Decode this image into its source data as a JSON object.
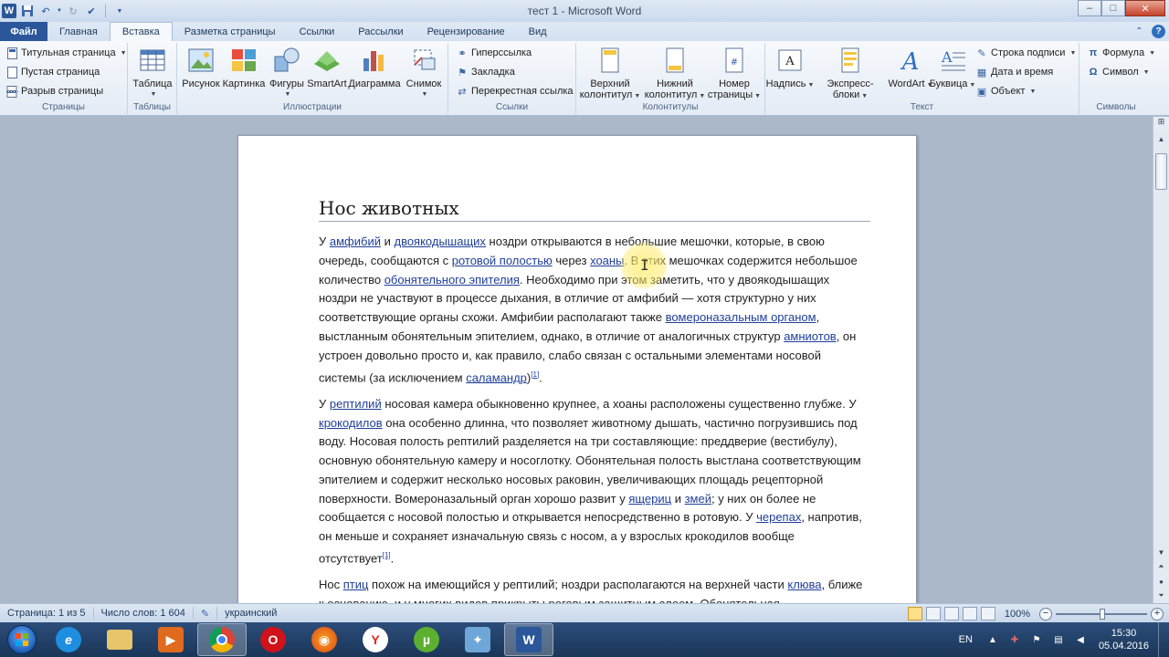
{
  "window": {
    "title": "тест 1 - Microsoft Word",
    "controls": {
      "minimize": "–",
      "maximize": "□",
      "close": "✕"
    }
  },
  "quick_access": {
    "app_letter": "W"
  },
  "tabs": [
    {
      "label": "Файл"
    },
    {
      "label": "Главная"
    },
    {
      "label": "Вставка"
    },
    {
      "label": "Разметка страницы"
    },
    {
      "label": "Ссылки"
    },
    {
      "label": "Рассылки"
    },
    {
      "label": "Рецензирование"
    },
    {
      "label": "Вид"
    }
  ],
  "ribbon": {
    "pages": {
      "label": "Страницы",
      "title_page": "Титульная страница",
      "blank_page": "Пустая страница",
      "page_break": "Разрыв страницы"
    },
    "tables": {
      "label": "Таблицы",
      "table": "Таблица"
    },
    "illustrations": {
      "label": "Иллюстрации",
      "picture": "Рисунок",
      "clipart": "Картинка",
      "shapes": "Фигуры",
      "smartart": "SmartArt",
      "chart": "Диаграмма",
      "screenshot": "Снимок"
    },
    "links": {
      "label": "Ссылки",
      "hyperlink": "Гиперссылка",
      "bookmark": "Закладка",
      "crossref": "Перекрестная ссылка"
    },
    "header_footer": {
      "label": "Колонтитулы",
      "header_1": "Верхний",
      "header_2": "колонтитул",
      "footer_1": "Нижний",
      "footer_2": "колонтитул",
      "pagenum_1": "Номер",
      "pagenum_2": "страницы"
    },
    "text": {
      "label": "Текст",
      "textbox": "Надпись",
      "quickparts": "Экспресс-блоки",
      "wordart": "WordArt",
      "dropcap": "Буквица",
      "signature": "Строка подписи",
      "datetime": "Дата и время",
      "object": "Объект"
    },
    "symbols": {
      "label": "Символы",
      "equation": "Формула",
      "symbol": "Символ"
    }
  },
  "document": {
    "heading": "Нос животных",
    "paragraphs": [
      [
        {
          "t": "У "
        },
        {
          "t": "амфибий",
          "link": true
        },
        {
          "t": " и "
        },
        {
          "t": "двоякодышащих",
          "link": true
        },
        {
          "t": " ноздри открываются в небольшие мешочки, которые, в свою очередь, сообщаются с "
        },
        {
          "t": "ротовой полостью",
          "link": true
        },
        {
          "t": " через "
        },
        {
          "t": "хоаны",
          "link": true
        },
        {
          "t": ". В этих мешочках содержится небольшое количество "
        },
        {
          "t": "обонятельного эпителия",
          "link": true
        },
        {
          "t": ". Необходимо при этом заметить, что у двоякодышащих ноздри не участвуют в процессе дыхания, в отличие от амфибий — хотя структурно у них соответствующие органы схожи. Амфибии располагают также "
        },
        {
          "t": "вомероназальным органом",
          "link": true
        },
        {
          "t": ", выстланным обонятельным эпителием, однако, в отличие от аналогичных структур "
        },
        {
          "t": "амниотов",
          "link": true
        },
        {
          "t": ", он устроен довольно просто и, как правило, слабо связан с остальными элементами носовой системы (за исключением "
        },
        {
          "t": "саламандр",
          "link": true
        },
        {
          "t": ")"
        },
        {
          "t": "[1]",
          "sup": true
        },
        {
          "t": "."
        }
      ],
      [
        {
          "t": "У "
        },
        {
          "t": "рептилий",
          "link": true
        },
        {
          "t": " носовая камера обыкновенно крупнее, а хоаны расположены существенно глубже. У "
        },
        {
          "t": "крокодилов",
          "link": true
        },
        {
          "t": " она особенно длинна, что позволяет животному дышать, частично погрузившись под воду. Носовая полость рептилий разделяется на три составляющие: преддверие (вестибулу), основную обонятельную камеру и носоглотку. Обонятельная полость выстлана соответствующим эпителием и содержит несколько носовых раковин, увеличивающих площадь рецепторной поверхности. Вомероназальный орган хорошо развит у "
        },
        {
          "t": "ящериц",
          "link": true
        },
        {
          "t": " и "
        },
        {
          "t": "змей",
          "link": true
        },
        {
          "t": "; у них он более не сообщается с носовой полостью и открывается непосредственно в ротовую. У "
        },
        {
          "t": "черепах",
          "link": true
        },
        {
          "t": ", напротив, он меньше и сохраняет изначальную связь с носом, а у взрослых крокодилов вообще отсутствует"
        },
        {
          "t": "[1]",
          "sup": true
        },
        {
          "t": "."
        }
      ],
      [
        {
          "t": "Нос "
        },
        {
          "t": "птиц",
          "link": true
        },
        {
          "t": " похож на имеющийся у рептилий; ноздри располагаются на верхней части "
        },
        {
          "t": "клюва",
          "link": true
        },
        {
          "t": ", ближе к основанию, и у многих видов прикрыты роговым защитным слоем. Обонятельная"
        }
      ]
    ]
  },
  "status": {
    "page": "Страница: 1 из 5",
    "words": "Число слов: 1 604",
    "language": "украинский",
    "zoom": "100%"
  },
  "taskbar": {
    "lang": "EN",
    "time": "15:30",
    "date": "05.04.2016"
  }
}
